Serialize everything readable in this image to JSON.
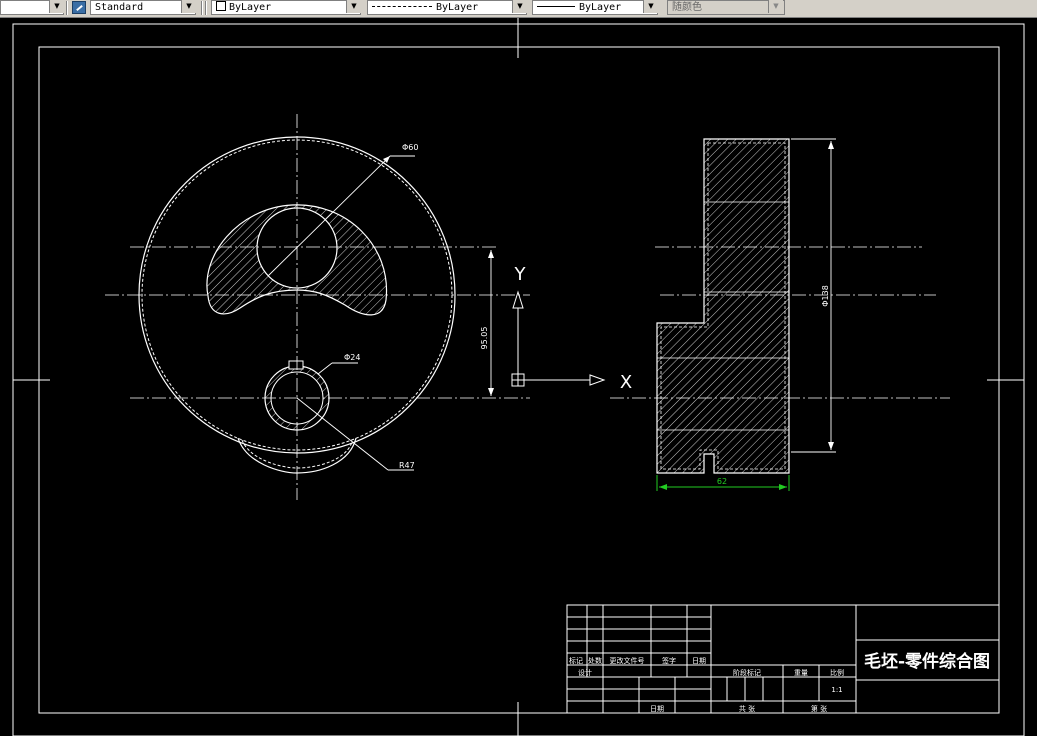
{
  "toolbar": {
    "text_style": "Standard",
    "layer": "ByLayer",
    "linetype": "ByLayer",
    "lineweight": "ByLayer",
    "color": "随颜色"
  },
  "colors": {
    "canvas_background": "#000000",
    "geometry": "#ffffff",
    "dimension_highlight": "#22cc22",
    "toolbar_face": "#d4d0c8"
  },
  "drawing": {
    "dim_outer_dia": "Φ60",
    "dim_hole_dia": "Φ24",
    "dim_radius": "R47",
    "dim_center_distance": "95.05",
    "dim_height": "Φ138",
    "dim_width": "62",
    "ucs_x": "X",
    "ucs_y": "Y"
  },
  "title_block": {
    "title": "毛坯-零件综合图",
    "scale_value": "1:1",
    "row_labels": [
      "标记",
      "处数",
      "更改文件号",
      "签字",
      "日期"
    ],
    "design": "设计",
    "date": "日期",
    "stage_mark": "阶段标记",
    "weight": "重量",
    "scale": "比例",
    "sheets_total": "共 张",
    "sheet_no": "第 张"
  }
}
